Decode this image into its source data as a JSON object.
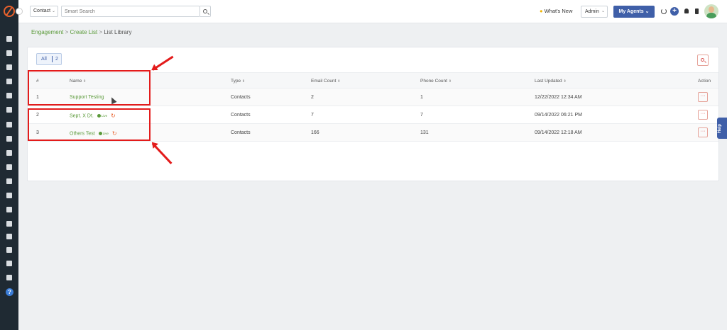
{
  "header": {
    "entity_select": "Contact",
    "search_placeholder": "Smart Search",
    "whats_new": "What's New",
    "admin_select": "Admin",
    "my_agents": "My Agents"
  },
  "breadcrumb": {
    "items": [
      "Engagement",
      "Create List",
      "List Library"
    ]
  },
  "filter": {
    "label": "All",
    "count": "2"
  },
  "table": {
    "columns": [
      "#",
      "Name",
      "Type",
      "Email Count",
      "Phone Count",
      "Last Updated",
      "Action"
    ],
    "rows": [
      {
        "num": "1",
        "name": "Support Testing",
        "live": "",
        "type": "Contacts",
        "email": "2",
        "phone": "1",
        "updated": "12/22/2022 12:34 AM"
      },
      {
        "num": "2",
        "name": "Sept. X Dt.",
        "live": "Live",
        "type": "Contacts",
        "email": "7",
        "phone": "7",
        "updated": "09/14/2022 06:21 PM"
      },
      {
        "num": "3",
        "name": "Others Test",
        "live": "Live",
        "type": "Contacts",
        "email": "166",
        "phone": "131",
        "updated": "09/14/2022 12:18 AM"
      }
    ],
    "action_label": "···"
  },
  "help_tab": "Help",
  "sidebar_help": "?",
  "colors": {
    "sidebar_bg": "#1f2a33",
    "accent_green": "#5b9a3a",
    "primary_blue": "#3f5fa8",
    "annotation_red": "#e31b1b"
  }
}
